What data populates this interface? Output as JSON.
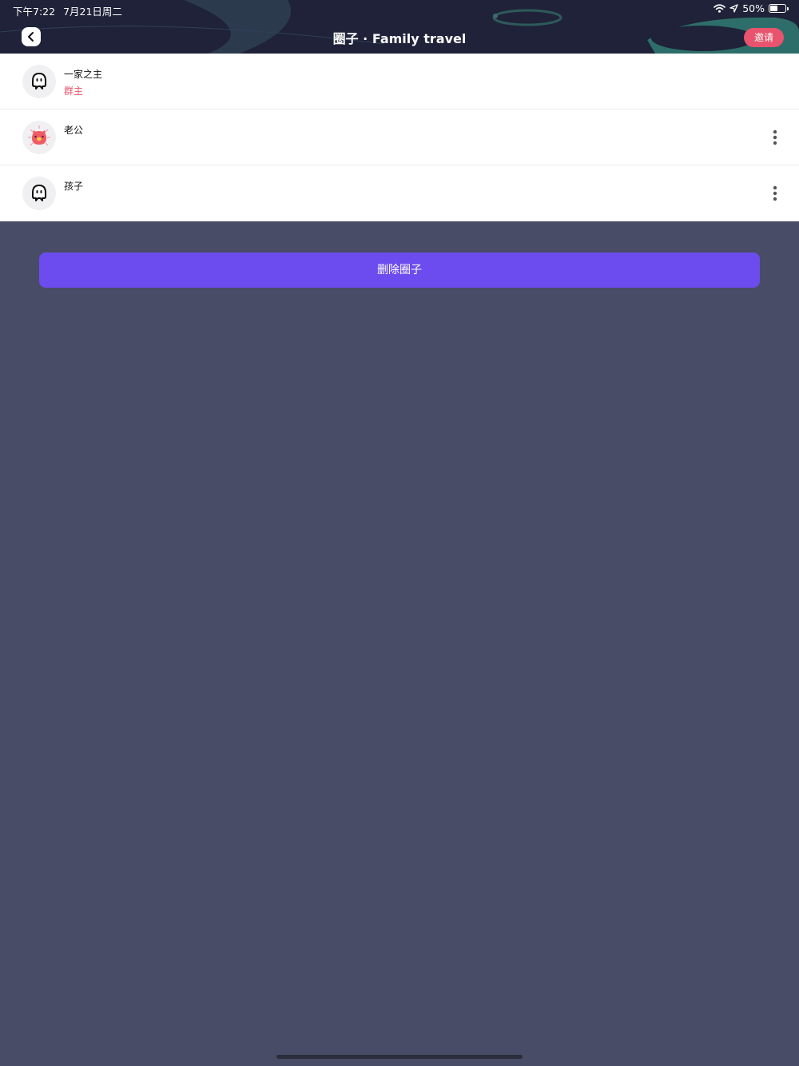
{
  "status_bar": {
    "time": "下午7:22",
    "date": "7月21日周二",
    "battery_text": "50%",
    "battery_level": 0.5,
    "wifi_icon": "wifi-icon",
    "location_icon": "location-arrow-icon"
  },
  "header": {
    "title": "圈子 · Family travel",
    "invite_label": "邀请",
    "back_icon": "chevron-left-icon"
  },
  "members": [
    {
      "name": "一家之主",
      "role": "群主",
      "avatar": "white-face-avatar",
      "has_more": false
    },
    {
      "name": "老公",
      "role": "",
      "avatar": "pink-cat-avatar",
      "has_more": true
    },
    {
      "name": "孩子",
      "role": "",
      "avatar": "white-face-avatar",
      "has_more": true
    }
  ],
  "actions": {
    "delete_label": "删除圈子"
  },
  "colors": {
    "accent_purple": "#6c4cee",
    "accent_pink": "#e8536d",
    "background": "#484c66",
    "header_bg": "#1f2238"
  }
}
